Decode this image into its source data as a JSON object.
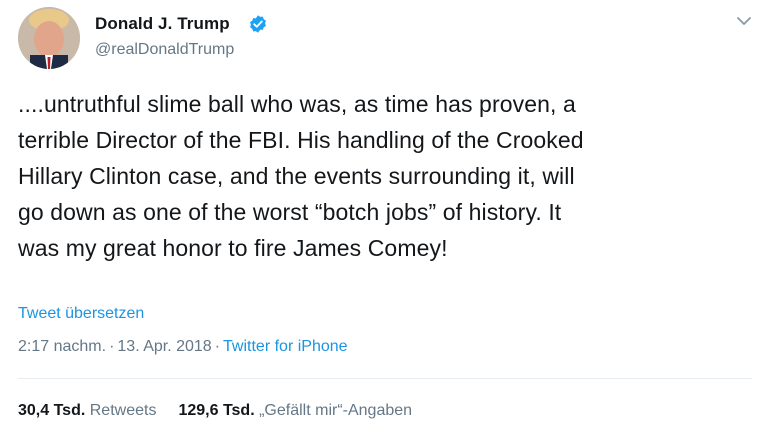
{
  "author": {
    "name": "Donald J. Trump",
    "handle": "@realDonaldTrump",
    "verified": true
  },
  "tweet": {
    "text": "....untruthful slime ball who was, as time has proven, a\nterrible Director of the FBI. His handling of the Crooked\nHillary Clinton case, and the events surrounding it, will\ngo down as one of the worst “botch jobs” of history. It\nwas my great honor to fire James Comey!",
    "translate_label": "Tweet übersetzen",
    "time": "2:17 nachm.",
    "separator": "·",
    "date": "13. Apr. 2018",
    "source": "Twitter for iPhone"
  },
  "stats": {
    "retweets_count": "30,4 Tsd.",
    "retweets_label": "Retweets",
    "likes_count": "129,6 Tsd.",
    "likes_label": "„Gefällt mir“-Angaben"
  },
  "icons": {
    "verified": "verified-badge-icon",
    "menu": "chevron-down-icon"
  },
  "colors": {
    "text": "#14171a",
    "secondary": "#657786",
    "link": "#1b95e0",
    "divider": "#e6ecf0"
  }
}
